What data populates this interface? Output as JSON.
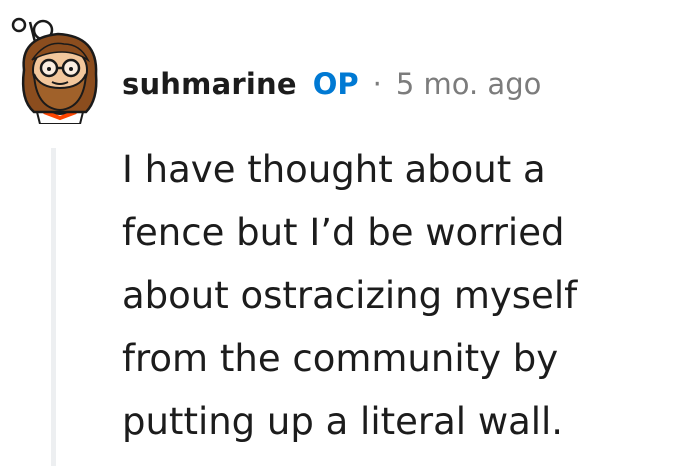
{
  "comment": {
    "author": {
      "username": "suhmarine",
      "badge": "OP",
      "avatar_icon": "snoo-avatar-icon"
    },
    "separator": "·",
    "timestamp": "5 mo. ago",
    "body_lines": [
      "I have thought about a",
      "fence but I’d be worried",
      "about ostracizing myself",
      "from the community by",
      "putting up a literal wall."
    ]
  },
  "colors": {
    "op_badge": "#0079d3",
    "username": "#1c1c1c",
    "meta_text": "#7c7c7c",
    "body_text": "#1c1c1c",
    "thread_line": "#edeff1"
  }
}
